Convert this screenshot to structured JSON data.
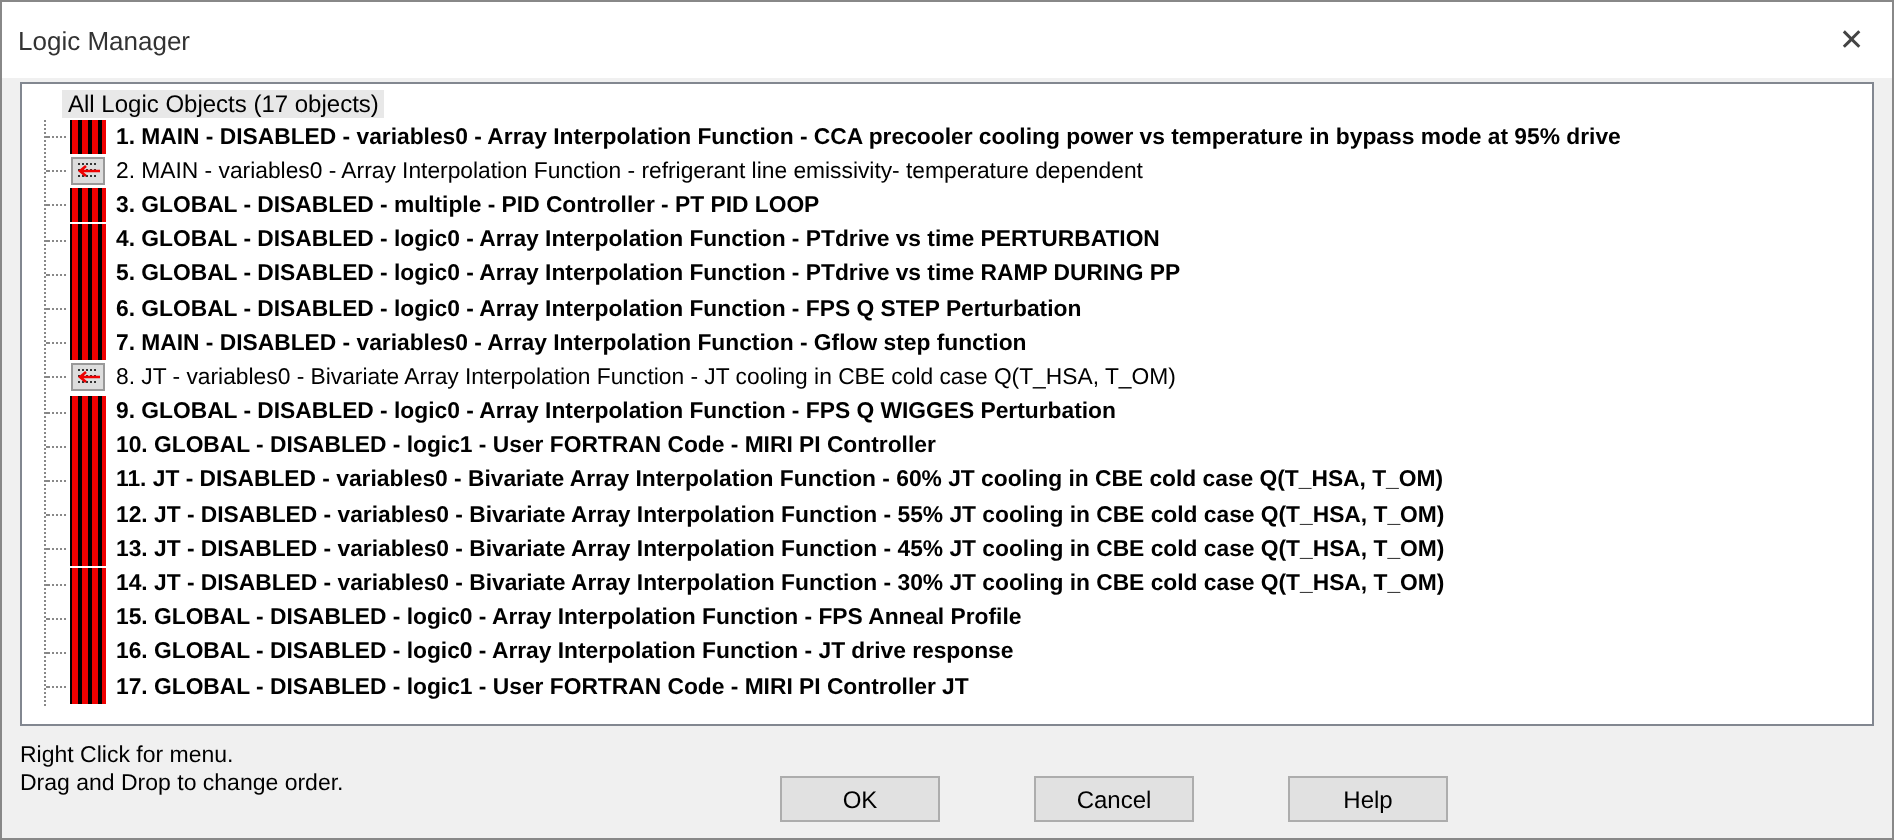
{
  "window": {
    "title": "Logic Manager",
    "close": "✕"
  },
  "tree": {
    "root": "All Logic Objects (17 objects)",
    "items": [
      {
        "label": "1. MAIN - DISABLED - variables0 - Array Interpolation Function - CCA precooler cooling power vs temperature in bypass mode at 95% drive",
        "disabled": true
      },
      {
        "label": "2. MAIN - variables0 - Array Interpolation Function - refrigerant line emissivity- temperature dependent",
        "disabled": false
      },
      {
        "label": "3. GLOBAL - DISABLED - multiple - PID Controller - PT PID LOOP",
        "disabled": true
      },
      {
        "label": "4. GLOBAL - DISABLED - logic0 - Array Interpolation Function - PTdrive vs time PERTURBATION",
        "disabled": true
      },
      {
        "label": "5. GLOBAL - DISABLED - logic0 - Array Interpolation Function - PTdrive vs time RAMP DURING PP",
        "disabled": true
      },
      {
        "label": "6. GLOBAL - DISABLED - logic0 - Array Interpolation Function - FPS Q STEP Perturbation",
        "disabled": true
      },
      {
        "label": "7. MAIN - DISABLED - variables0 - Array Interpolation Function - Gflow step function",
        "disabled": true
      },
      {
        "label": "8. JT - variables0 - Bivariate Array Interpolation Function - JT cooling in CBE cold case  Q(T_HSA, T_OM)",
        "disabled": false
      },
      {
        "label": "9. GLOBAL - DISABLED - logic0 - Array Interpolation Function - FPS Q WIGGES  Perturbation",
        "disabled": true
      },
      {
        "label": "10. GLOBAL - DISABLED - logic1 - User FORTRAN Code - MIRI PI Controller",
        "disabled": true
      },
      {
        "label": "11. JT - DISABLED - variables0 - Bivariate Array Interpolation Function - 60% JT cooling in CBE cold case  Q(T_HSA, T_OM)",
        "disabled": true
      },
      {
        "label": "12. JT - DISABLED - variables0 - Bivariate Array Interpolation Function - 55% JT cooling in CBE cold case  Q(T_HSA, T_OM)",
        "disabled": true
      },
      {
        "label": "13. JT - DISABLED - variables0 - Bivariate Array Interpolation Function - 45% JT cooling in CBE cold case  Q(T_HSA, T_OM)",
        "disabled": true
      },
      {
        "label": "14. JT - DISABLED - variables0 - Bivariate Array Interpolation Function - 30% JT cooling in CBE cold case  Q(T_HSA, T_OM)",
        "disabled": true
      },
      {
        "label": "15. GLOBAL - DISABLED - logic0 - Array Interpolation Function - FPS Anneal Profile",
        "disabled": true
      },
      {
        "label": "16. GLOBAL - DISABLED - logic0 - Array Interpolation Function - JT drive response",
        "disabled": true
      },
      {
        "label": "17. GLOBAL - DISABLED - logic1 - User FORTRAN Code - MIRI PI Controller JT",
        "disabled": true
      }
    ]
  },
  "hints": [
    "Right Click for menu.",
    "Drag and Drop to change order."
  ],
  "buttons": [
    "OK",
    "Cancel",
    "Help"
  ]
}
